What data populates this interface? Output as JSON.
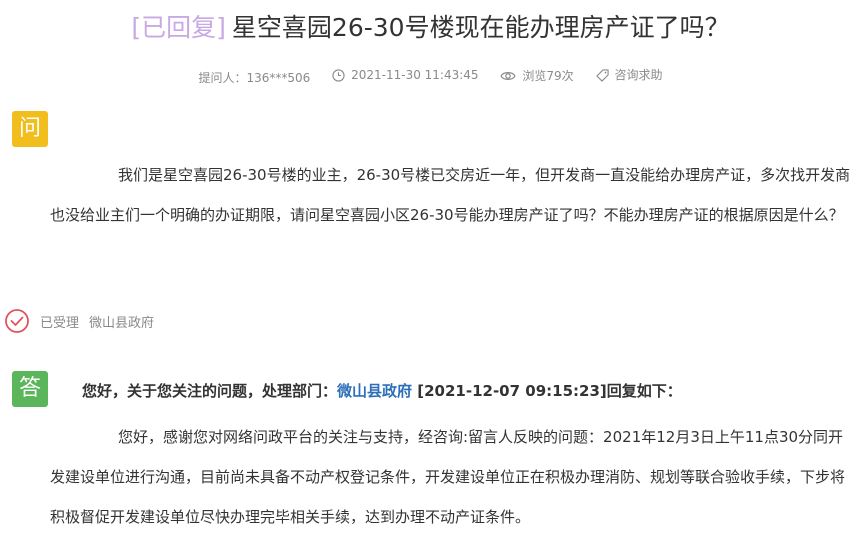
{
  "question": {
    "status_tag": "[已回复]",
    "title": "星空喜园26-30号楼现在能办理房产证了吗？",
    "meta": {
      "asker": "提问人：136***506",
      "datetime": "2021-11-30 11:43:45",
      "views": "浏览79次",
      "category": "咨询求助"
    },
    "badge": "问",
    "content": "我们是星空喜园26-30号楼的业主，26-30号楼已交房近一年，但开发商一直没能给办理房产证，多次找开发商也没给业主们一个明确的办证期限，请问星空喜园小区26-30号能办理房产证了吗？不能办理房产证的根据原因是什么？"
  },
  "accept_status": {
    "label": "已受理",
    "department": "微山县政府"
  },
  "answer": {
    "badge": "答",
    "head_prefix": "您好，关于您关注的问题，处理部门：",
    "department": "微山县政府",
    "head_suffix": " [2021-12-07 09:15:23]回复如下：",
    "content": "您好，感谢您对网络问政平台的关注与支持，经咨询:留言人反映的问题：2021年12月3日上午11点30分同开发建设单位进行沟通，目前尚未具备不动产权登记条件，开发建设单位正在积极办理消防、规划等联合验收手续，下步将积极督促开发建设单位尽快办理完毕相关手续，达到办理不动产证条件。"
  },
  "icons": {
    "time": "clock-icon",
    "views": "eye-icon",
    "category": "tag-icon",
    "accepted": "check-circle-icon"
  },
  "colors": {
    "status_tag": "#c9a9e3",
    "question_badge": "#f1be1e",
    "answer_badge": "#5bb55b",
    "accepted_icon": "#e0525e",
    "department_link": "#2d6fb8"
  }
}
